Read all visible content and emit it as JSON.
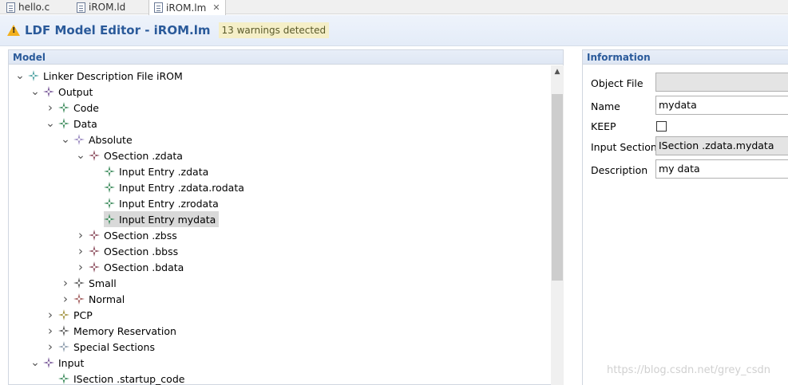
{
  "tabs": [
    {
      "label": "hello.c"
    },
    {
      "label": "iROM.ld"
    },
    {
      "label": "iROM.lm"
    }
  ],
  "header": {
    "title": "LDF Model Editor - iROM.lm",
    "warnings": "13 warnings detected"
  },
  "model_panel": {
    "title": "Model",
    "tree": [
      {
        "label": "Linker Description File iROM",
        "level": 0,
        "expander": "open",
        "icon_color": "#4aa0a0"
      },
      {
        "label": "Output",
        "level": 1,
        "expander": "open",
        "icon_color": "#7a5a9a"
      },
      {
        "label": "Code",
        "level": 2,
        "expander": "closed",
        "icon_color": "#3a8a5a"
      },
      {
        "label": "Data",
        "level": 2,
        "expander": "open",
        "icon_color": "#3a8a5a"
      },
      {
        "label": "Absolute",
        "level": 3,
        "expander": "open",
        "icon_color": "#9a8ac0"
      },
      {
        "label": "OSection .zdata",
        "level": 4,
        "expander": "open",
        "icon_color": "#8a4a5a"
      },
      {
        "label": "Input Entry .zdata",
        "level": 5,
        "expander": "none",
        "icon_color": "#3a8a5a"
      },
      {
        "label": "Input Entry .zdata.rodata",
        "level": 5,
        "expander": "none",
        "icon_color": "#3a8a5a"
      },
      {
        "label": "Input Entry .zrodata",
        "level": 5,
        "expander": "none",
        "icon_color": "#3a8a5a"
      },
      {
        "label": "Input Entry mydata",
        "level": 5,
        "expander": "none",
        "icon_color": "#3a8a5a",
        "selected": true
      },
      {
        "label": "OSection .zbss",
        "level": 4,
        "expander": "closed",
        "icon_color": "#8a4a5a"
      },
      {
        "label": "OSection .bbss",
        "level": 4,
        "expander": "closed",
        "icon_color": "#8a4a5a"
      },
      {
        "label": "OSection .bdata",
        "level": 4,
        "expander": "closed",
        "icon_color": "#8a4a5a"
      },
      {
        "label": "Small",
        "level": 3,
        "expander": "closed",
        "icon_color": "#555555"
      },
      {
        "label": "Normal",
        "level": 3,
        "expander": "closed",
        "icon_color": "#a05a5a"
      },
      {
        "label": "PCP",
        "level": 2,
        "expander": "closed",
        "icon_color": "#a0903a"
      },
      {
        "label": "Memory Reservation",
        "level": 2,
        "expander": "closed",
        "icon_color": "#555555"
      },
      {
        "label": "Special Sections",
        "level": 2,
        "expander": "closed",
        "icon_color": "#8a9aaa"
      },
      {
        "label": "Input",
        "level": 1,
        "expander": "open",
        "icon_color": "#7a5a9a"
      },
      {
        "label": "ISection .startup_code",
        "level": 2,
        "expander": "none",
        "icon_color": "#3a8a5a"
      }
    ]
  },
  "info_panel": {
    "title": "Information",
    "object_file_label": "Object File",
    "object_file_value": "",
    "name_label": "Name",
    "name_value": "mydata",
    "keep_label": "KEEP",
    "keep_checked": false,
    "input_section_label": "Input Section",
    "input_section_value": "ISection .zdata.mydata",
    "description_label": "Description",
    "description_value": "my data"
  },
  "watermark": "https://blog.csdn.net/grey_csdn"
}
